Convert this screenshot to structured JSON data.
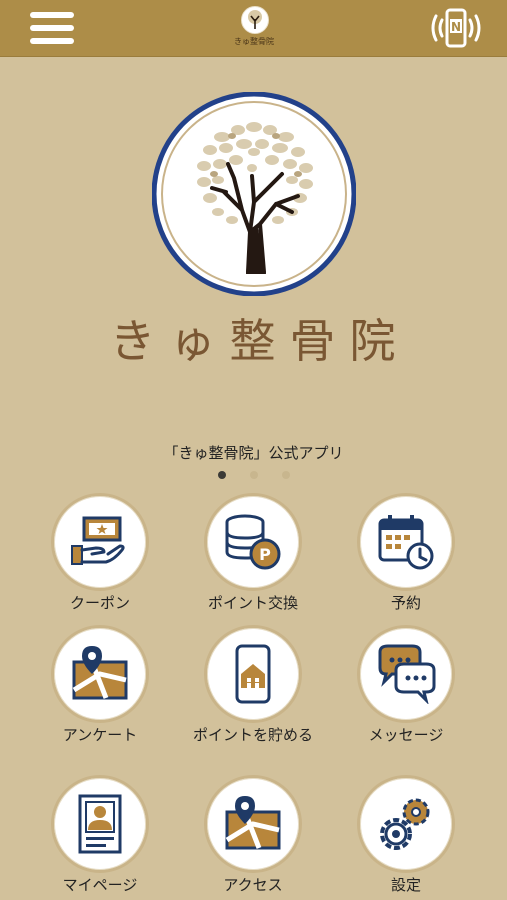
{
  "header": {
    "logo_text": "きゅ整骨院"
  },
  "brand": {
    "name": "きゅ整骨院"
  },
  "subtitle": "「きゅ整骨院」公式アプリ",
  "carousel": {
    "total": 3,
    "active": 1
  },
  "menu": [
    {
      "label": "クーポン",
      "icon": "coupon-icon"
    },
    {
      "label": "ポイント交換",
      "icon": "point-exchange-icon"
    },
    {
      "label": "予約",
      "icon": "calendar-clock-icon"
    },
    {
      "label": "アンケート",
      "icon": "survey-map-icon"
    },
    {
      "label": "ポイントを貯める",
      "icon": "phone-store-icon"
    },
    {
      "label": "メッセージ",
      "icon": "chat-bubbles-icon"
    },
    {
      "label": "マイページ",
      "icon": "profile-card-icon"
    },
    {
      "label": "アクセス",
      "icon": "map-pin-icon"
    },
    {
      "label": "設定",
      "icon": "gears-icon"
    }
  ],
  "colors": {
    "background": "#d2c19b",
    "header": "#ad8d48",
    "navy": "#1f3a66",
    "gold": "#b8863b",
    "brand_text": "#7a5733"
  }
}
